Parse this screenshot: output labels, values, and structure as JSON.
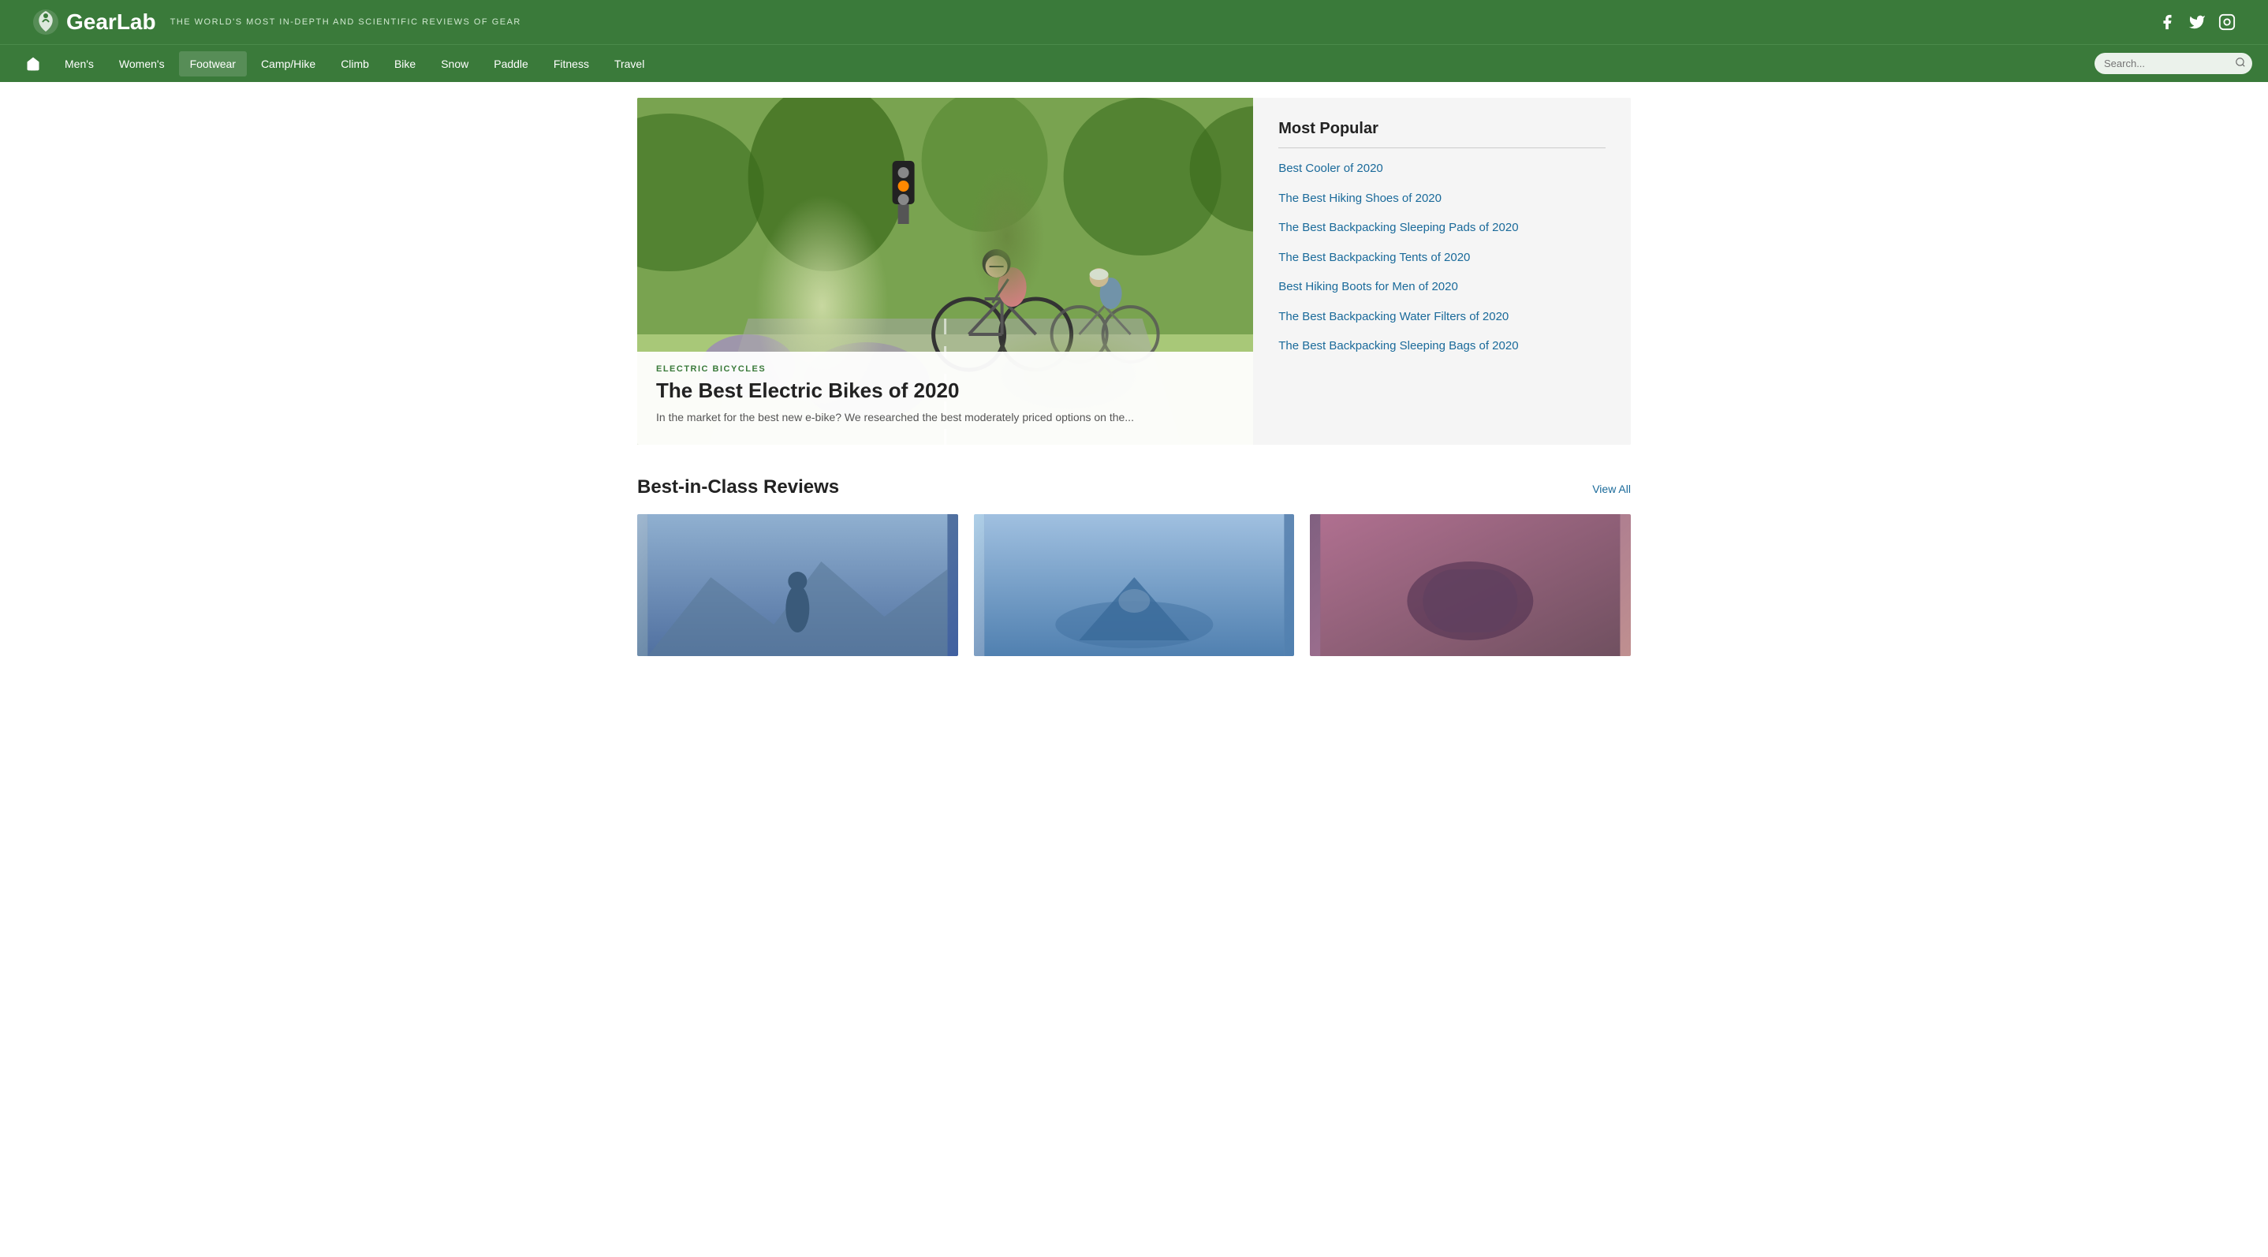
{
  "site": {
    "logo_text": "GearLab",
    "tagline": "THE WORLD'S MOST IN-DEPTH AND SCIENTIFIC REVIEWS OF GEAR"
  },
  "topbar": {
    "social": {
      "facebook_label": "Facebook",
      "twitter_label": "Twitter",
      "instagram_label": "Instagram"
    }
  },
  "nav": {
    "home_label": "Home",
    "items": [
      {
        "label": "Men's",
        "id": "mens"
      },
      {
        "label": "Women's",
        "id": "womens"
      },
      {
        "label": "Footwear",
        "id": "footwear",
        "active": true
      },
      {
        "label": "Camp/Hike",
        "id": "camphike"
      },
      {
        "label": "Climb",
        "id": "climb"
      },
      {
        "label": "Bike",
        "id": "bike"
      },
      {
        "label": "Snow",
        "id": "snow"
      },
      {
        "label": "Paddle",
        "id": "paddle"
      },
      {
        "label": "Fitness",
        "id": "fitness"
      },
      {
        "label": "Travel",
        "id": "travel"
      }
    ],
    "search_placeholder": "Search..."
  },
  "hero": {
    "category": "ELECTRIC BICYCLES",
    "title": "The Best Electric Bikes of 2020",
    "excerpt": "In the market for the best new e-bike? We researched the best moderately priced options on the..."
  },
  "sidebar": {
    "title": "Most Popular",
    "items": [
      {
        "label": "Best Cooler of 2020"
      },
      {
        "label": "The Best Hiking Shoes of 2020"
      },
      {
        "label": "The Best Backpacking Sleeping Pads of 2020"
      },
      {
        "label": "The Best Backpacking Tents of 2020"
      },
      {
        "label": "Best Hiking Boots for Men of 2020"
      },
      {
        "label": "The Best Backpacking Water Filters of 2020"
      },
      {
        "label": "The Best Backpacking Sleeping Bags of 2020"
      }
    ]
  },
  "best_in_class": {
    "section_title": "Best-in-Class Reviews",
    "view_all": "View All",
    "cards": [
      {
        "id": "card-1",
        "color_class": "card-img-1"
      },
      {
        "id": "card-2",
        "color_class": "card-img-2"
      },
      {
        "id": "card-3",
        "color_class": "card-img-3"
      }
    ]
  }
}
